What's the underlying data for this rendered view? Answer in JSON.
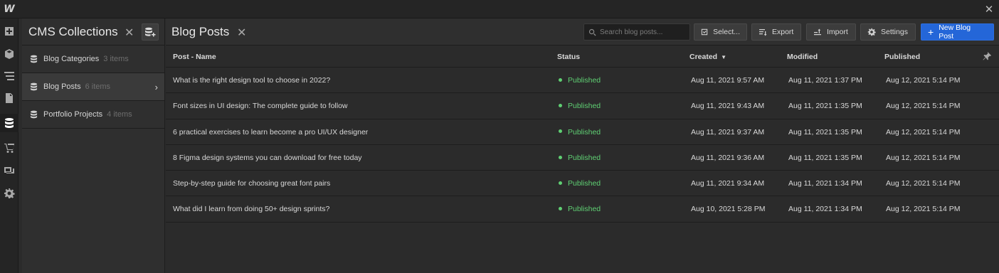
{
  "app": {
    "logo": "W",
    "close_glyph": "✕"
  },
  "rail": {
    "icons": [
      "add-icon",
      "box-icon",
      "navigator-icon",
      "pages-icon",
      "cms-icon",
      "ecommerce-icon",
      "assets-icon",
      "settings-icon"
    ],
    "active": "cms-icon"
  },
  "collections": {
    "title": "CMS Collections",
    "close_glyph": "✕",
    "items": [
      {
        "name": "Blog Categories",
        "count": "3 items",
        "selected": false
      },
      {
        "name": "Blog Posts",
        "count": "6 items",
        "selected": true
      },
      {
        "name": "Portfolio Projects",
        "count": "4 items",
        "selected": false
      }
    ]
  },
  "main": {
    "title": "Blog Posts",
    "close_glyph": "✕",
    "search_placeholder": "Search blog posts...",
    "buttons": {
      "select": "Select...",
      "export": "Export",
      "import": "Import",
      "settings": "Settings",
      "new_post": "New Blog Post"
    }
  },
  "table": {
    "columns": {
      "name": "Post - Name",
      "status": "Status",
      "created": "Created",
      "modified": "Modified",
      "published": "Published"
    },
    "sorted_by": "created",
    "rows": [
      {
        "name": "What is the right design tool to choose in 2022?",
        "status": "Published",
        "created": "Aug 11, 2021 9:57 AM",
        "modified": "Aug 11, 2021 1:37 PM",
        "published": "Aug 12, 2021 5:14 PM"
      },
      {
        "name": "Font sizes in UI design: The complete guide to follow",
        "status": "Published",
        "created": "Aug 11, 2021 9:43 AM",
        "modified": "Aug 11, 2021 1:35 PM",
        "published": "Aug 12, 2021 5:14 PM"
      },
      {
        "name": "6 practical exercises to learn become a pro UI/UX designer",
        "status": "Published",
        "created": "Aug 11, 2021 9:37 AM",
        "modified": "Aug 11, 2021 1:35 PM",
        "published": "Aug 12, 2021 5:14 PM"
      },
      {
        "name": "8 Figma design systems you can download for free today",
        "status": "Published",
        "created": "Aug 11, 2021 9:36 AM",
        "modified": "Aug 11, 2021 1:35 PM",
        "published": "Aug 12, 2021 5:14 PM"
      },
      {
        "name": "Step-by-step guide for choosing great font pairs",
        "status": "Published",
        "created": "Aug 11, 2021 9:34 AM",
        "modified": "Aug 11, 2021 1:34 PM",
        "published": "Aug 12, 2021 5:14 PM"
      },
      {
        "name": "What did I learn from doing 50+ design sprints?",
        "status": "Published",
        "created": "Aug 10, 2021 5:28 PM",
        "modified": "Aug 11, 2021 1:34 PM",
        "published": "Aug 12, 2021 5:14 PM"
      }
    ]
  },
  "colors": {
    "accent": "#2466d8",
    "status_published": "#5fcf73"
  }
}
